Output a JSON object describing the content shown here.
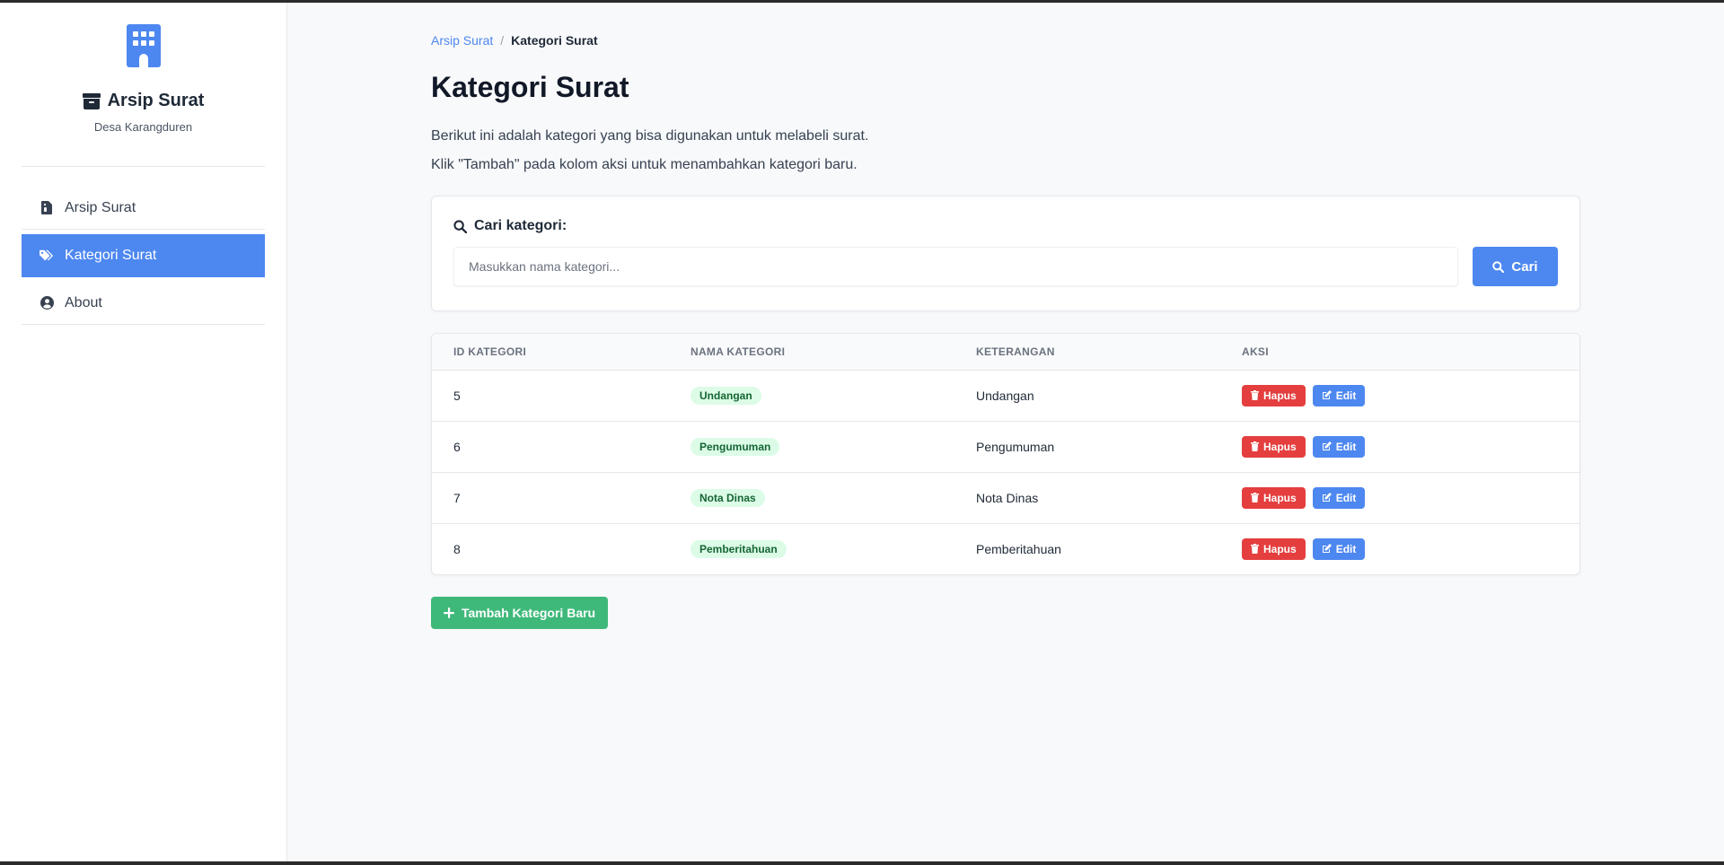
{
  "sidebar": {
    "brand_title": "Arsip Surat",
    "brand_subtitle": "Desa Karangduren",
    "items": [
      {
        "label": "Arsip Surat",
        "icon": "file-icon",
        "active": false
      },
      {
        "label": "Kategori Surat",
        "icon": "tags-icon",
        "active": true
      },
      {
        "label": "About",
        "icon": "user-circle-icon",
        "active": false
      }
    ]
  },
  "breadcrumb": {
    "parent": "Arsip Surat",
    "separator": "/",
    "current": "Kategori Surat"
  },
  "page": {
    "title": "Kategori Surat",
    "desc_line1": "Berikut ini adalah kategori yang bisa digunakan untuk melabeli surat.",
    "desc_line2": "Klik \"Tambah\" pada kolom aksi untuk menambahkan kategori baru."
  },
  "search": {
    "label": "Cari kategori:",
    "placeholder": "Masukkan nama kategori...",
    "value": "",
    "button_label": "Cari"
  },
  "table": {
    "headers": [
      "ID KATEGORI",
      "NAMA KATEGORI",
      "KETERANGAN",
      "AKSI"
    ],
    "rows": [
      {
        "id": "5",
        "nama": "Undangan",
        "keterangan": "Undangan"
      },
      {
        "id": "6",
        "nama": "Pengumuman",
        "keterangan": "Pengumuman"
      },
      {
        "id": "7",
        "nama": "Nota Dinas",
        "keterangan": "Nota Dinas"
      },
      {
        "id": "8",
        "nama": "Pemberitahuan",
        "keterangan": "Pemberitahuan"
      }
    ],
    "delete_label": "Hapus",
    "edit_label": "Edit"
  },
  "add_button_label": "Tambah Kategori Baru",
  "colors": {
    "accent": "#4d87f0",
    "danger": "#e53e3e",
    "success": "#3fb97a",
    "badge_bg": "#dcfce7",
    "badge_text": "#166534"
  }
}
